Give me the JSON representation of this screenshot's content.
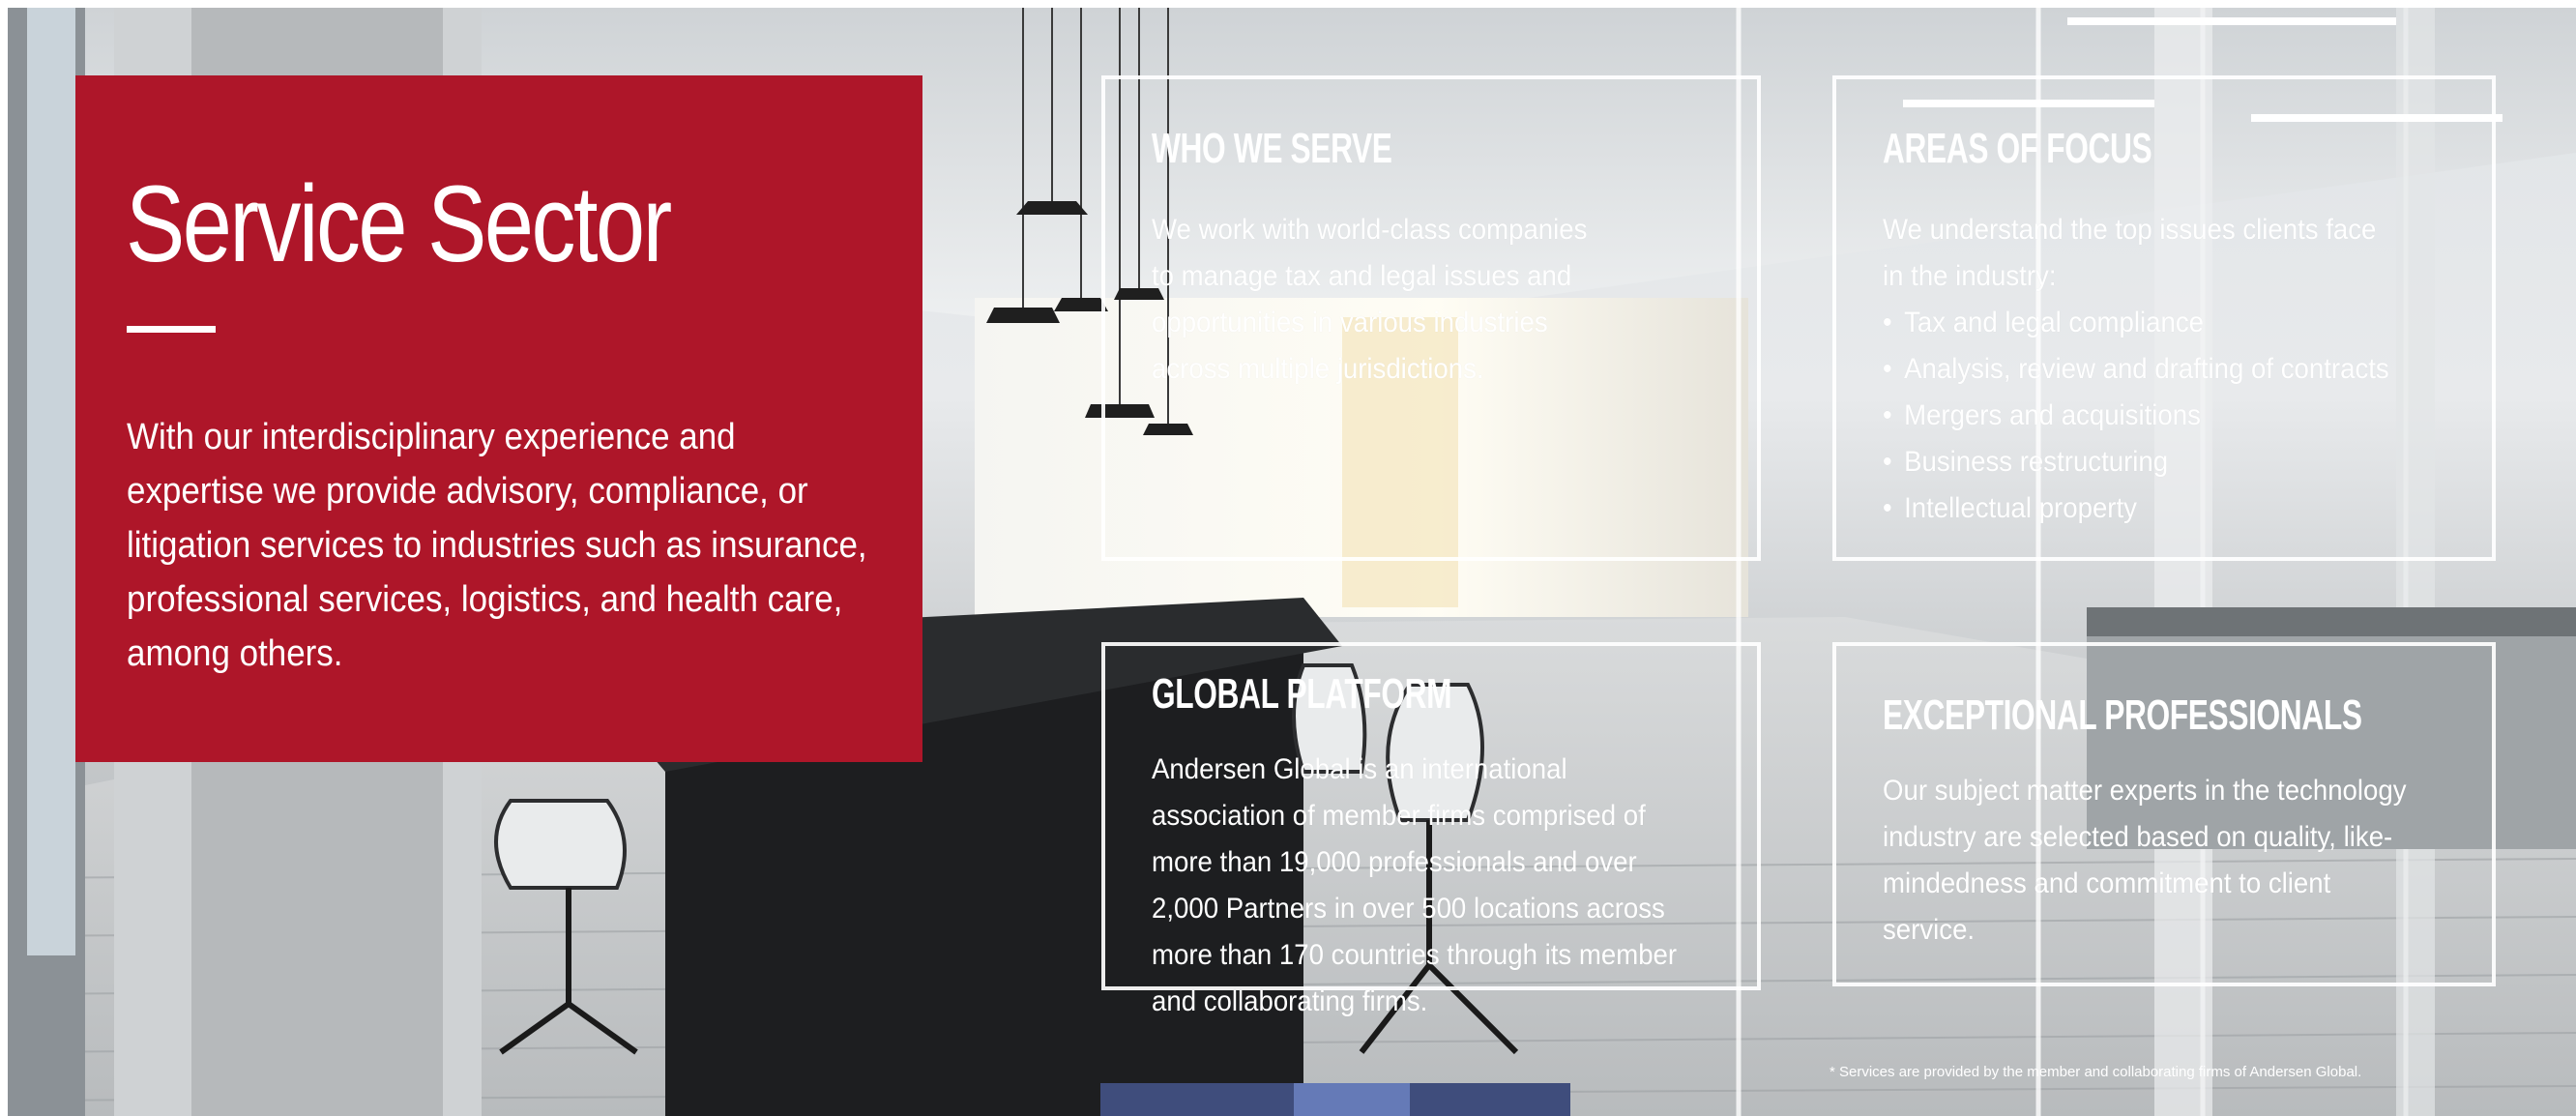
{
  "hero": {
    "title": "Service Sector",
    "body": "With our interdisciplinary experience and expertise we provide advisory, compliance, or litigation services to industries such as insurance, professional services, logistics, and health care, among others."
  },
  "cards": {
    "who_we_serve": {
      "title": "WHO WE SERVE",
      "text": "We work with world-class companies to manage tax and legal issues and opportunities in various industries across multiple jurisdictions."
    },
    "areas_of_focus": {
      "title": "AREAS OF FOCUS",
      "intro": "We understand the top issues clients face in the industry:",
      "items": [
        "Tax and legal compliance",
        "Analysis, review and drafting of contracts",
        "Mergers and acquisitions",
        "Business restructuring",
        "Intellectual property"
      ]
    },
    "global_platform": {
      "title": "GLOBAL PLATFORM",
      "text": "Andersen Global is an international association of member firms comprised of more than 19,000 professionals and over 2,000 Partners in over 500 locations across more than 170 countries through its member and collaborating firms."
    },
    "exceptional_professionals": {
      "title": "EXCEPTIONAL PROFESSIONALS",
      "text": "Our subject matter experts in the technology industry are selected based on quality, like-mindedness and commitment to client service."
    }
  },
  "footnote": "* Services are provided by the member and collaborating firms of Andersen Global.",
  "colors": {
    "brand_red": "#ae1629",
    "text": "#ffffff"
  }
}
